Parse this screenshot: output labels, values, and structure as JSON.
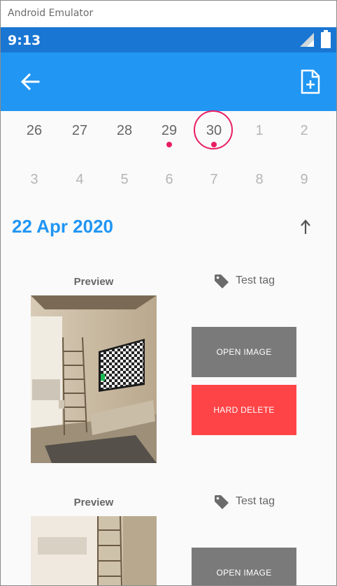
{
  "window": {
    "title": "Android Emulator"
  },
  "status_bar": {
    "time": "9:13"
  },
  "app_bar": {
    "back_icon": "arrow-back-icon",
    "action_icon": "note-add-icon",
    "color": "#2196f3"
  },
  "calendar": {
    "row1": [
      "26",
      "27",
      "28",
      "29",
      "30",
      "1",
      "2"
    ],
    "row2": [
      "3",
      "4",
      "5",
      "6",
      "7",
      "8",
      "9"
    ],
    "selected_day": "30",
    "marked_days": [
      "29",
      "30"
    ],
    "accent": "#e91e63"
  },
  "section": {
    "date": "22 Apr 2020",
    "sort_icon": "arrow-upward-icon"
  },
  "entries": [
    {
      "preview_label": "Preview",
      "tag_label": "Test tag",
      "open_label": "OPEN IMAGE",
      "delete_label": "HARD DELETE"
    },
    {
      "preview_label": "Preview",
      "tag_label": "Test tag",
      "open_label": "OPEN IMAGE"
    }
  ]
}
